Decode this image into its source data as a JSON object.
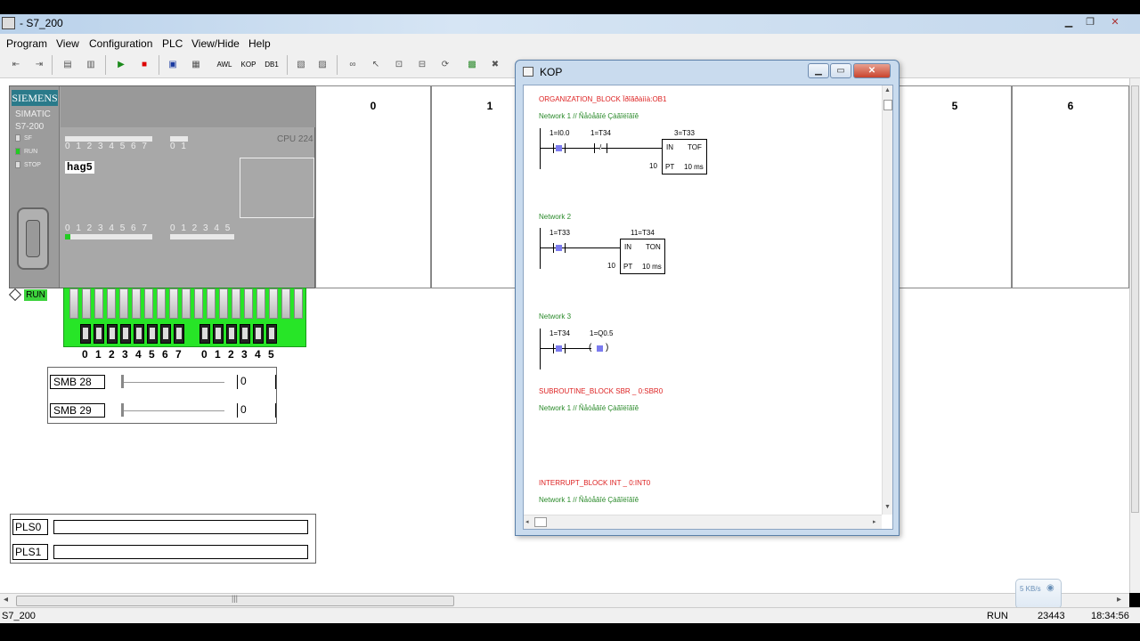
{
  "window": {
    "title": "- S7_200"
  },
  "menu": [
    "Program",
    "View",
    "Configuration",
    "PLC",
    "View/Hide",
    "Help"
  ],
  "toolbar": {
    "awl_label": "AWL",
    "kop_label": "KOP",
    "db1_label": "DB1"
  },
  "plc": {
    "brand": "SIEMENS",
    "series": "SIMATIC",
    "model": "S7-200",
    "leds": [
      "SF",
      "RUN",
      "STOP"
    ],
    "cpu": "CPU 224",
    "module_name": "hag5",
    "input_digits": "0 1 2 3 4 5 6 7",
    "input_digits_b": "0 1",
    "output_digits": "0 1 2 3 4 5 6 7",
    "output_digits_b": "0 1 2 3 4 5",
    "led_colors": {
      "run": "#22cc22",
      "off": "#dddddd"
    }
  },
  "slots": [
    "0",
    "1",
    "5",
    "6"
  ],
  "run_indicator": "RUN",
  "switches": {
    "labels": [
      "0",
      "1",
      "2",
      "3",
      "4",
      "5",
      "6",
      "7",
      "0",
      "1",
      "2",
      "3",
      "4",
      "5"
    ]
  },
  "smb": [
    {
      "label": "SMB 28",
      "value": "0",
      "level": 0
    },
    {
      "label": "SMB 29",
      "value": "0",
      "level": 0
    }
  ],
  "pls": [
    "PLS0",
    "PLS1"
  ],
  "kop": {
    "title": "KOP",
    "ob_header": "ORGANIZATION_BLOCK Ïðîãðàììà:OB1",
    "net1_title": "Network 1 // Ñåòåâîé Çàãîëîâîê",
    "net1": {
      "c1": "1=I0.0",
      "c2": "1=T34",
      "box_addr": "3=T33",
      "in": "IN",
      "type": "TOF",
      "pt_val": "10",
      "pt": "PT",
      "ms": "10 ms",
      "slash": "/"
    },
    "net2_title": "Network 2",
    "net2": {
      "c1": "1=T33",
      "box_addr": "11=T34",
      "in": "IN",
      "type": "TON",
      "pt_val": "10",
      "pt": "PT",
      "ms": "10 ms"
    },
    "net3_title": "Network 3",
    "net3": {
      "c1": "1=T34",
      "coil": "1=Q0.5"
    },
    "sbr_header": "SUBROUTINE_BLOCK SBR _  0:SBR0",
    "sbr_net": "Network 1 // Ñåòåâîé Çàãîëîâîê",
    "int_header": "INTERRUPT_BLOCK INT _  0:INT0",
    "int_net": "Network 1 // Ñåòåâîé Çàãîëîâîê"
  },
  "status": {
    "app": "S7_200",
    "mode": "RUN",
    "count": "23443",
    "time": "18:34:56"
  },
  "netmeter": {
    "rate": "5 KB/s"
  }
}
